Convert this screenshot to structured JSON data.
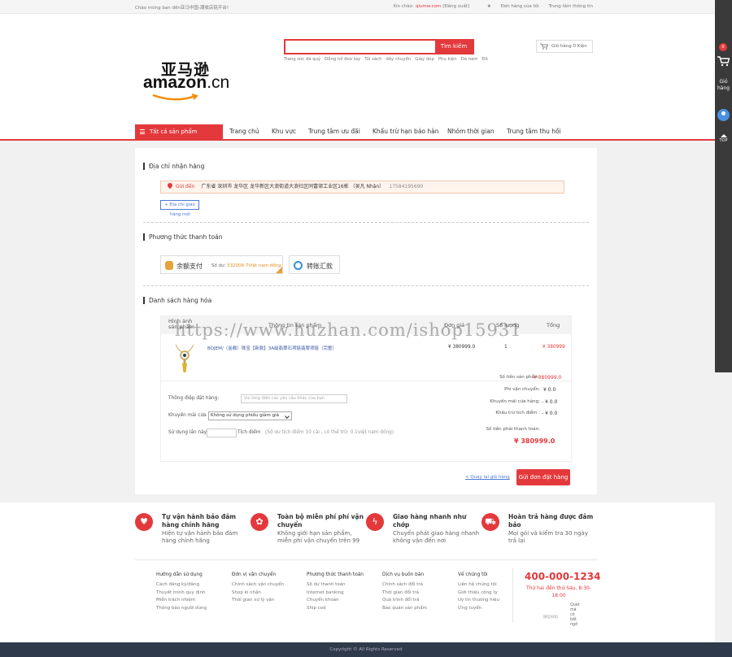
{
  "topbar": {
    "welcome": "Chào mừng bạn đến亚马中国-潮收店铭平台!",
    "hello": "Xin chào:",
    "username": "qiumw.com",
    "logout": "[Đăng xuất]",
    "orders": "Đơn hàng của tôi",
    "help": "Trung tâm thông tin"
  },
  "header": {
    "logo_cn": "亚马逊",
    "logo_en": "amazon",
    "logo_tld": ".cn",
    "search_btn": "Tìm kiếm",
    "search_value": "",
    "cart_mini": "Giỏ hàng 0 Kiện",
    "hotwords": [
      "Trang sức đá quý",
      "Đồng hồ đeo tay",
      "Túi sách",
      "dây chuyền",
      "Giày dép",
      "Phụ kiện",
      "Đá nam",
      "Đồ"
    ]
  },
  "nav": {
    "all_categories": "Tất cả sản phẩm",
    "items": [
      "Trang chủ",
      "Khu vực",
      "Trung tâm ưu đãi",
      "Khấu trừ hạn bảo hàn",
      "Nhóm thời gian",
      "Trung tâm thu hồi"
    ]
  },
  "address": {
    "title": "Địa chỉ nhận hàng",
    "send": "Gửi đến",
    "detail": "广东省 深圳市 龙华区 龙华新区大浪街道大浪社区同富邨工业区16栋 （吴凡 Nhận）",
    "phone": "17584195690",
    "new_btn": "+ Địa chỉ giao",
    "new_btn2": "hàng mới"
  },
  "payment": {
    "title": "Phương thức thanh toán",
    "balance_label": "余额支付",
    "balance_prefix": "Số dư:",
    "balance_value": "532006.7Việt nam đồng",
    "transfer_label": "转账汇款"
  },
  "goods": {
    "title": "Danh sách hàng hóa",
    "headers": [
      "Hình ảnh sản phẩm",
      "Thông tin sản phẩm",
      "Đơn giá",
      "Số lượng",
      "Tổng"
    ],
    "items": [
      {
        "name": "BOJEM/（金都）珠宝【新款】3A级翡翠石项链翡翠项链（完整）",
        "price": "¥ 380999.0",
        "qty": "1",
        "subtotal": "¥ 380999"
      }
    ],
    "message_label": "Thông điệp đặt hàng:",
    "message_placeholder": "Vui lòng điền các yêu cầu khác của bạn",
    "promo_label": "Khuyến mãi cửa hàng:",
    "promo_value": "Không sử dụng phiếu giảm giá",
    "points_label": "Sử dụng lần này:",
    "points_unit": "Tích điểm",
    "points_note": "(Số dư tích điểm 10 cải , có thể trừ: 0.1việt nam đồng)",
    "summary": [
      {
        "label": "Số tiền sản phẩm:",
        "value": "¥ 380999.0"
      },
      {
        "label": "Phí vận chuyển:",
        "value": "¥ 0.0"
      },
      {
        "label": "Khuyến mãi cửa hàng:",
        "value": "- ¥ 0.0"
      },
      {
        "label": "Khấu trừ tích điểm :",
        "value": "- ¥ 0.0"
      }
    ],
    "total_label": "Số tiền phải thanh toán:",
    "total_value": "¥ 380999.0",
    "back": "< Quay lại giỏ hàng",
    "submit": "Gửi đơn đặt hàng"
  },
  "watermark": "https://www.huzhan.com/ishop15931",
  "services": [
    {
      "title": "Tự vận hành bảo đảm hàng chính hãng",
      "desc": "Hiện tự vận hành bảo đảm hàng chính hãng",
      "icon": "shield-icon"
    },
    {
      "title": "Toàn bộ miễn phí phí vận chuyển",
      "desc": "Không giới hạn sản phẩm, miễn phí vận chuyển trên 99",
      "icon": "hand-heart-icon"
    },
    {
      "title": "Giao hàng nhanh như chớp",
      "desc": "Chuyển phát giao hàng nhanh không vận đến nơi",
      "icon": "lightning-icon"
    },
    {
      "title": "Hoàn trả hàng được đảm bảo",
      "desc": "Mọi gói và kiểm tra 30 ngày trả lại",
      "icon": "truck-icon"
    }
  ],
  "footer_cols": [
    {
      "title": "Hướng dẫn sử dụng",
      "links": [
        "Cách đăng ký/đăng",
        "Thuyết minh quy định",
        "Miễn trách nhiệm",
        "Thông báo người dùng"
      ]
    },
    {
      "title": "Đơn vị vận chuyển",
      "links": [
        "Chính sách vận chuyển",
        "Shop kí nhận",
        "Thời gian xử lý vận"
      ]
    },
    {
      "title": "Phương thức thanh toán",
      "links": [
        "Số dư thanh toán",
        "Internet banking",
        "Chuyển khoản",
        "Ship cod"
      ]
    },
    {
      "title": "Dịch vụ buôn bán",
      "links": [
        "Chính sách đổi trả",
        "Thời gian đổi trả",
        "Quá trình đổi trả",
        "Bảo quản sản phẩm"
      ]
    },
    {
      "title": "Về chúng tôi",
      "links": [
        "Liên hệ chúng tôi",
        "Giới thiệu công ty",
        "Uy tín thương hiệu",
        "Ứng tuyển"
      ]
    }
  ],
  "contact": {
    "phone": "400-000-1234",
    "hours": "Thứ hai đến thứ Sáu, 8:30-18:00",
    "qr_alt": "微信扫码",
    "qr_text": "Quét mã có bất ngờ"
  },
  "copyright": "Copyright © All Rights Reserved",
  "sidebar": {
    "cart_count": "0",
    "cart_label": "Giỏ hàng",
    "top_label": "TOP"
  },
  "colors": {
    "accent": "#e4393c",
    "footer_bg": "#2f3a4c",
    "sidebar_bg": "#3a3a3a"
  }
}
